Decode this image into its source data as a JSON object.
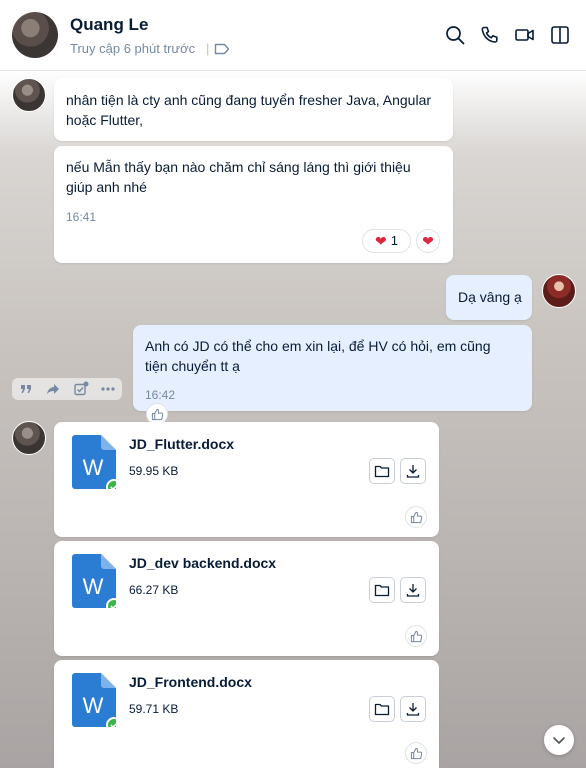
{
  "header": {
    "name": "Quang Le",
    "status": "Truy cập 6 phút trước",
    "separator": "|"
  },
  "messages": {
    "m1": {
      "text_line1": "nhân tiện là cty anh cũng đang tuyển fresher Java, Angular",
      "text_line2": "hoặc Flutter,"
    },
    "m2": {
      "text_line1": "nếu Mẫn thấy bạn nào chăm chỉ sáng láng thì giới thiệu",
      "text_line2": "giúp anh nhé",
      "time": "16:41",
      "reaction_count": "1",
      "reaction_icon": "heart"
    },
    "m3": {
      "text": "Dạ vâng ạ"
    },
    "m4": {
      "text_line1": "Anh có JD có thể cho em xin lại, để HV có hỏi, em cũng",
      "text_line2": "tiện chuyển tt ạ",
      "time": "16:42"
    }
  },
  "files": [
    {
      "name": "JD_Flutter.docx",
      "size": "59.95 KB",
      "type_letter": "W"
    },
    {
      "name": "JD_dev backend.docx",
      "size": "66.27 KB",
      "type_letter": "W"
    },
    {
      "name": "JD_Frontend.docx",
      "size": "59.71 KB",
      "type_letter": "W"
    }
  ],
  "colors": {
    "accent": "#0068ff",
    "word_blue": "#2b7cd3",
    "sent_bubble": "#e5efff",
    "check_green": "#3bb54a",
    "heart_red": "#e0263c"
  }
}
